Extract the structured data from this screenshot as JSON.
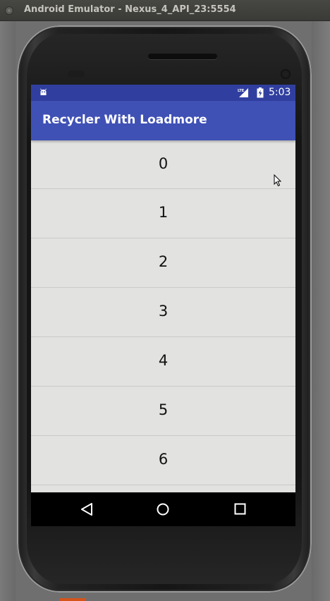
{
  "window": {
    "title": "Android Emulator - Nexus_4_API_23:5554"
  },
  "status_bar": {
    "time": "5:03",
    "icons": [
      "android-debug-icon",
      "lte-signal-icon",
      "battery-charging-icon"
    ]
  },
  "app_bar": {
    "title": "Recycler With Loadmore"
  },
  "list": {
    "items": [
      "0",
      "1",
      "2",
      "3",
      "4",
      "5",
      "6"
    ]
  },
  "nav_bar": {
    "buttons": [
      "back",
      "home",
      "recents"
    ]
  },
  "colors": {
    "status_bar": "#303f9f",
    "app_bar": "#3f51b5",
    "list_background": "#e2e2e0",
    "nav_bar": "#000000"
  }
}
